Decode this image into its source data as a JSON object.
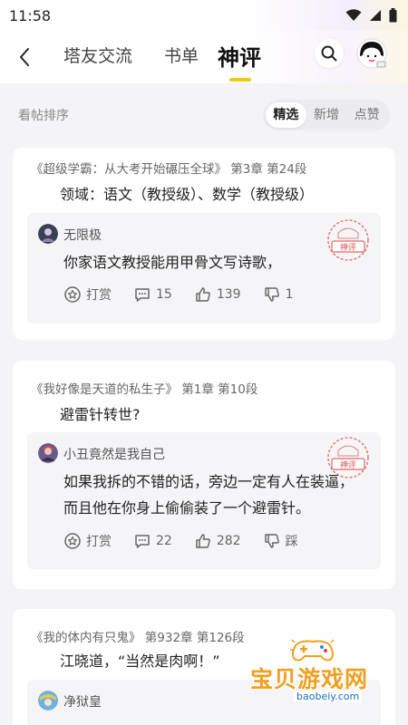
{
  "status_bar": {
    "time": "11:58"
  },
  "header": {
    "tabs": [
      {
        "label": "塔友交流",
        "active": false
      },
      {
        "label": "书单",
        "active": false
      },
      {
        "label": "神评",
        "active": true
      }
    ],
    "accent_color": "#f5c518"
  },
  "sort": {
    "label": "看帖排序",
    "options": [
      "精选",
      "新增",
      "点赞"
    ],
    "selected": "精选"
  },
  "posts": [
    {
      "source": "《超级学霸：从大考开始碾压全球》 第3章 第24段",
      "quote": "领域：语文（教授级）、数学（教授级）",
      "user": "无限极",
      "comment": "你家语文教授能用甲骨文写诗歌，",
      "stamp": "神评",
      "reward_label": "打赏",
      "comments": "15",
      "likes": "139",
      "dislikes": "1"
    },
    {
      "source": "《我好像是天道的私生子》 第1章 第10段",
      "quote": "避雷针转世?",
      "user": "小丑竟然是我自己",
      "comment": "如果我拆的不错的话，旁边一定有人在装逼，而且他在你身上偷偷装了一个避雷针。",
      "stamp": "神评",
      "reward_label": "打赏",
      "comments": "22",
      "likes": "282",
      "dislikes": "踩"
    },
    {
      "source": "《我的体内有只鬼》 第932章 第126段",
      "quote": "江晓道，“当然是肉啊！”",
      "user": "净狱皇",
      "comment": "",
      "stamp": ""
    }
  ],
  "watermark": {
    "text": "宝贝游戏网",
    "url": "baobeiy.com"
  }
}
